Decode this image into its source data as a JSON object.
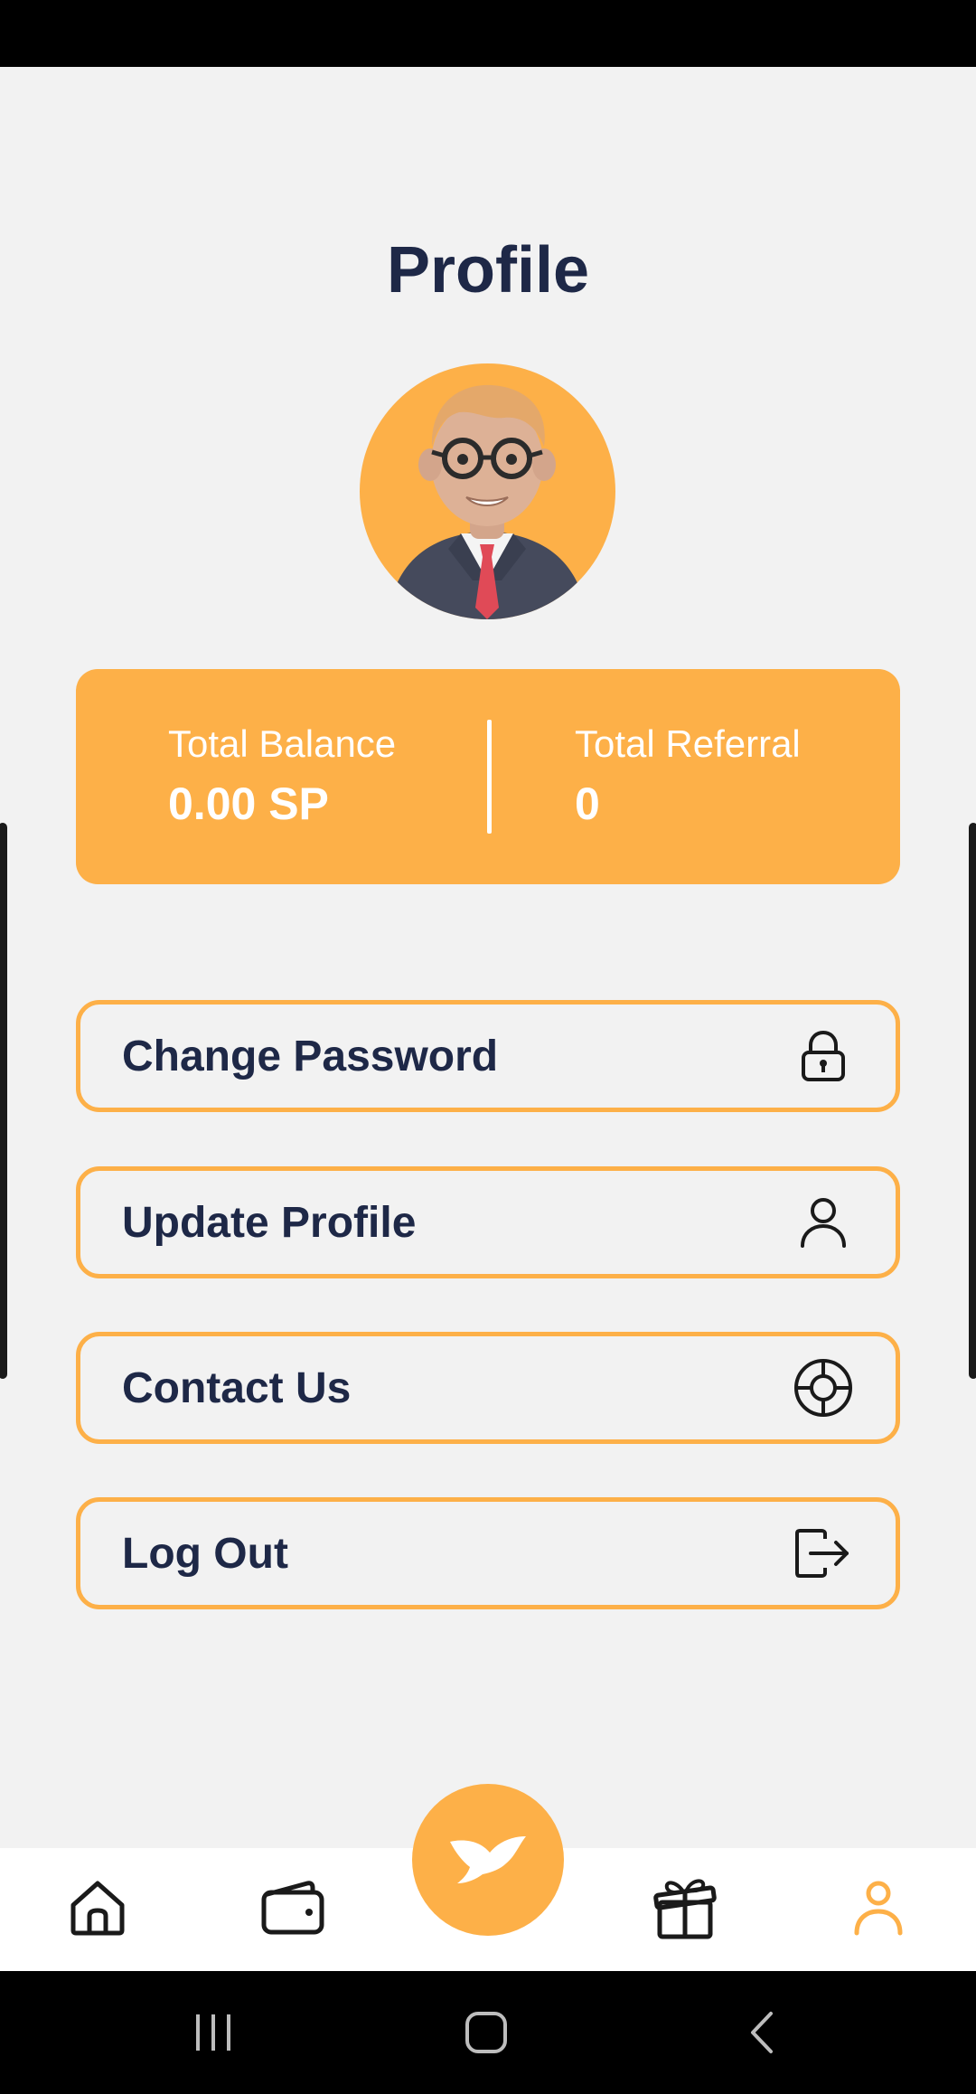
{
  "header": {
    "title": "Profile"
  },
  "balance_card": {
    "total_balance_label": "Total Balance",
    "total_balance_value": "0.00 SP",
    "total_referral_label": "Total Referral",
    "total_referral_value": "0"
  },
  "menu": [
    {
      "label": "Change Password",
      "icon": "lock-icon"
    },
    {
      "label": "Update Profile",
      "icon": "user-icon"
    },
    {
      "label": "Contact Us",
      "icon": "lifebuoy-icon"
    },
    {
      "label": "Log Out",
      "icon": "logout-icon"
    }
  ],
  "bottom_nav": {
    "items": [
      "home-icon",
      "wallet-icon",
      "bird-icon",
      "gift-icon",
      "user-icon"
    ],
    "active": "profile"
  },
  "colors": {
    "accent": "#fdb048",
    "text_dark": "#1e2847",
    "background": "#f2f2f2"
  }
}
